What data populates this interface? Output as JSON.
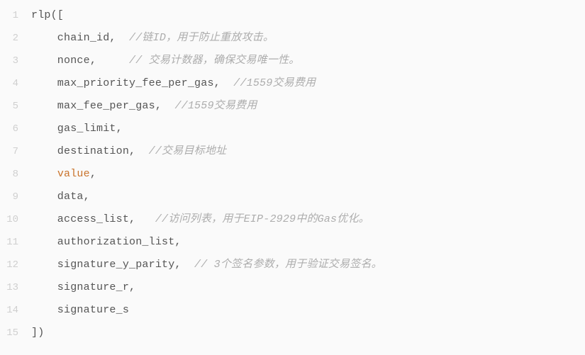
{
  "code": {
    "lines": [
      {
        "num": "1",
        "segs": [
          {
            "cls": "tok-plain",
            "text": "rlp(["
          }
        ]
      },
      {
        "num": "2",
        "segs": [
          {
            "cls": "tok-plain",
            "text": "    chain_id,  "
          },
          {
            "cls": "tok-comment",
            "text": "//链ID，用于防止重放攻击。"
          }
        ]
      },
      {
        "num": "3",
        "segs": [
          {
            "cls": "tok-plain",
            "text": "    nonce,     "
          },
          {
            "cls": "tok-comment",
            "text": "// 交易计数器，确保交易唯一性。"
          }
        ]
      },
      {
        "num": "4",
        "segs": [
          {
            "cls": "tok-plain",
            "text": "    max_priority_fee_per_gas,  "
          },
          {
            "cls": "tok-comment",
            "text": "//1559交易费用"
          }
        ]
      },
      {
        "num": "5",
        "segs": [
          {
            "cls": "tok-plain",
            "text": "    max_fee_per_gas,  "
          },
          {
            "cls": "tok-comment",
            "text": "//1559交易费用"
          }
        ]
      },
      {
        "num": "6",
        "segs": [
          {
            "cls": "tok-plain",
            "text": "    gas_limit,"
          }
        ]
      },
      {
        "num": "7",
        "segs": [
          {
            "cls": "tok-plain",
            "text": "    destination,  "
          },
          {
            "cls": "tok-comment",
            "text": "//交易目标地址"
          }
        ]
      },
      {
        "num": "8",
        "segs": [
          {
            "cls": "tok-plain",
            "text": "    "
          },
          {
            "cls": "tok-value",
            "text": "value"
          },
          {
            "cls": "tok-plain",
            "text": ","
          }
        ]
      },
      {
        "num": "9",
        "segs": [
          {
            "cls": "tok-plain",
            "text": "    data,"
          }
        ]
      },
      {
        "num": "10",
        "segs": [
          {
            "cls": "tok-plain",
            "text": "    access_list,   "
          },
          {
            "cls": "tok-comment",
            "text": "//访问列表，用于EIP-2929中的Gas优化。"
          }
        ]
      },
      {
        "num": "11",
        "segs": [
          {
            "cls": "tok-plain",
            "text": "    authorization_list,"
          }
        ]
      },
      {
        "num": "12",
        "segs": [
          {
            "cls": "tok-plain",
            "text": "    signature_y_parity,  "
          },
          {
            "cls": "tok-comment",
            "text": "// 3个签名参数，用于验证交易签名。"
          }
        ]
      },
      {
        "num": "13",
        "segs": [
          {
            "cls": "tok-plain",
            "text": "    signature_r,"
          }
        ]
      },
      {
        "num": "14",
        "segs": [
          {
            "cls": "tok-plain",
            "text": "    signature_s"
          }
        ]
      },
      {
        "num": "15",
        "segs": [
          {
            "cls": "tok-plain",
            "text": "])"
          }
        ]
      }
    ]
  }
}
